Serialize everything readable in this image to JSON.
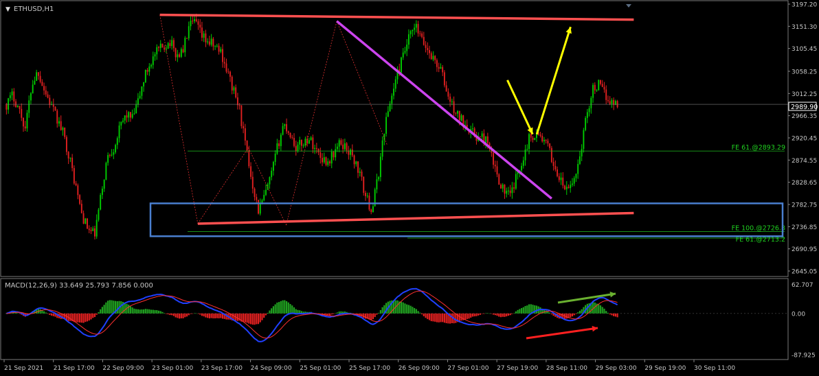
{
  "window": {
    "symbol_title": "ETHUSD,H1",
    "last_price_label": "2989.90"
  },
  "main_axis": {
    "ylim": [
      2645.05,
      3197.2
    ],
    "ticks": [
      "3197.20",
      "3151.30",
      "3105.45",
      "3058.25",
      "3012.25",
      "2966.35",
      "2920.45",
      "2874.55",
      "2828.65",
      "2782.75",
      "2736.85",
      "2690.95",
      "2645.05"
    ]
  },
  "macd": {
    "label": "MACD(12,26,9) 33.649 25.793 7.856 0.000",
    "ylim": [
      -87.93,
      62.707
    ],
    "ticks": [
      "62.707",
      "0.00",
      "-87.925"
    ]
  },
  "x_axis_labels": [
    "21 Sep 2021",
    "21 Sep 17:00",
    "22 Sep 09:00",
    "23 Sep 01:00",
    "23 Sep 17:00",
    "24 Sep 09:00",
    "25 Sep 01:00",
    "25 Sep 17:00",
    "26 Sep 09:00",
    "27 Sep 01:00",
    "27 Sep 19:00",
    "28 Sep 11:00",
    "29 Sep 03:00",
    "29 Sep 19:00",
    "30 Sep 11:00"
  ],
  "fibo_levels": [
    {
      "label": "FE 61.@2893.29",
      "price": 2893.29
    },
    {
      "label": "FE 100.@2726.8",
      "price": 2726.8
    },
    {
      "label": "FE 61.@2713.2",
      "price": 2713.2
    }
  ],
  "colors": {
    "background": "#000000",
    "bull": "#00cc00",
    "bear": "#e02020",
    "resistance": "#ff5050",
    "trendline": "#cc44ee",
    "projection": "#ffff00",
    "zone": "#4a7fd0",
    "macd_line": "#2040ff",
    "signal_line": "#ff3030"
  },
  "chart_data": [
    {
      "type": "candlestick",
      "title": "ETHUSD,H1",
      "ylim": [
        2645.05,
        3197.2
      ],
      "x_labels": [
        "21 Sep 2021",
        "21 Sep 17:00",
        "22 Sep 09:00",
        "23 Sep 01:00",
        "23 Sep 17:00",
        "24 Sep 09:00",
        "25 Sep 01:00",
        "25 Sep 17:00",
        "26 Sep 09:00",
        "27 Sep 01:00",
        "27 Sep 19:00",
        "28 Sep 11:00",
        "29 Sep 03:00",
        "29 Sep 19:00",
        "30 Sep 11:00"
      ],
      "price_path": [
        2990,
        3010,
        2980,
        2940,
        3030,
        3060,
        3020,
        2990,
        2960,
        2930,
        2880,
        2820,
        2760,
        2730,
        2720,
        2800,
        2880,
        2900,
        2940,
        2970,
        2960,
        3000,
        3050,
        3080,
        3100,
        3110,
        3120,
        3090,
        3100,
        3150,
        3160,
        3130,
        3120,
        3110,
        3100,
        3060,
        3020,
        2980,
        2900,
        2830,
        2770,
        2800,
        2840,
        2900,
        2950,
        2930,
        2900,
        2910,
        2920,
        2900,
        2880,
        2870,
        2890,
        2910,
        2900,
        2880,
        2850,
        2800,
        2770,
        2840,
        2940,
        3000,
        3050,
        3090,
        3130,
        3150,
        3120,
        3100,
        3080,
        3060,
        3010,
        2980,
        2960,
        2950,
        2930,
        2920,
        2920,
        2880,
        2840,
        2810,
        2800,
        2840,
        2880,
        2920,
        2930,
        2920,
        2900,
        2860,
        2830,
        2810,
        2830,
        2880,
        2960,
        3020,
        3030,
        3010,
        2995,
        2990
      ],
      "annotations": [
        {
          "kind": "resistance",
          "from": {
            "i": 24,
            "price": 3175
          },
          "to": {
            "i": 99,
            "price": 3165
          }
        },
        {
          "kind": "support",
          "from": {
            "i": 30,
            "price": 2743
          },
          "to": {
            "i": 99,
            "price": 2765
          }
        },
        {
          "kind": "descending-trendline",
          "from": {
            "i": 52,
            "price": 3162
          },
          "to": {
            "i": 86,
            "price": 2795
          }
        },
        {
          "kind": "projection",
          "points": [
            {
              "i": 79,
              "price": 3040
            },
            {
              "i": 83,
              "price": 2928
            },
            {
              "i": 89,
              "price": 3150
            }
          ]
        },
        {
          "kind": "demand-zone",
          "price_top": 2785,
          "price_bottom": 2717
        }
      ]
    },
    {
      "type": "macd",
      "title": "MACD(12,26,9) 33.649 25.793 7.856 0.000",
      "ylim": [
        -87.93,
        62.707
      ],
      "values": {
        "main": 33.649,
        "signal": 25.793,
        "histogram": 7.856
      },
      "annotations": [
        {
          "kind": "bullish-divergence-arrow",
          "color": "#ff2020"
        },
        {
          "kind": "rising-arrow",
          "color": "#6ab030"
        }
      ]
    }
  ]
}
